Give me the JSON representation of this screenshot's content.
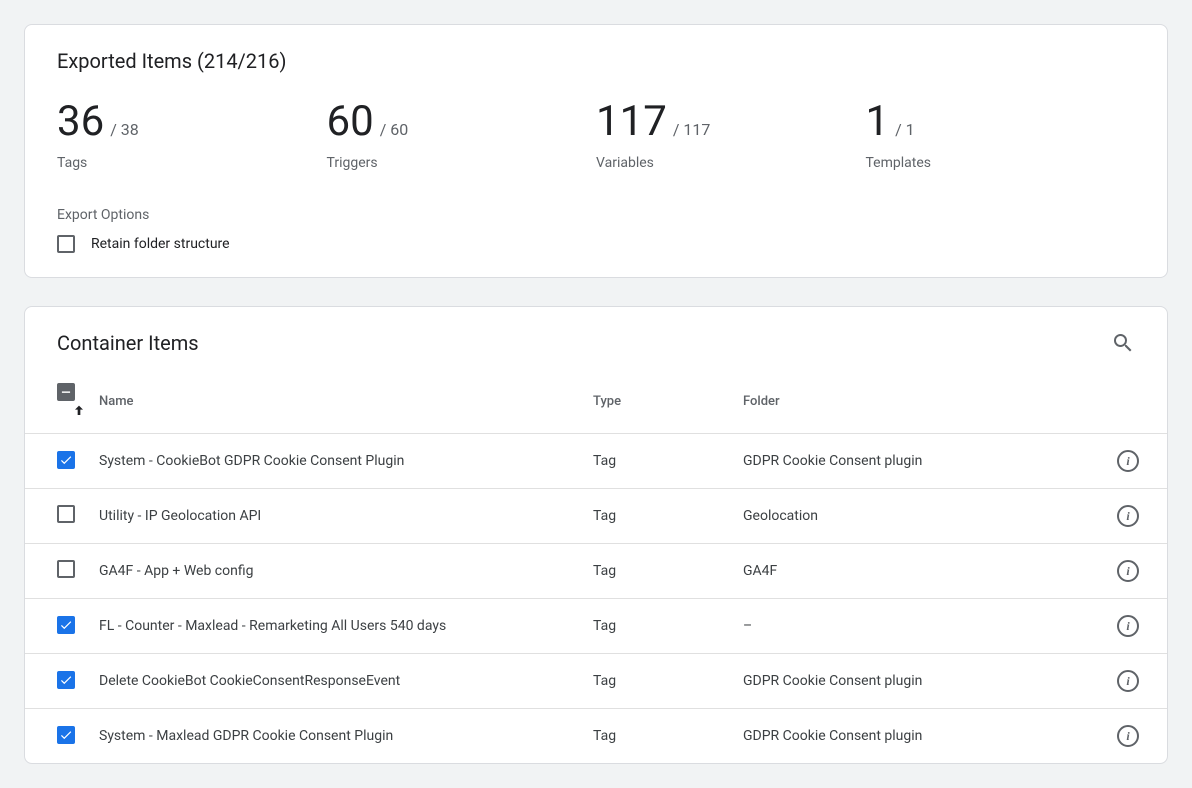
{
  "summary": {
    "title": "Exported Items (214/216)",
    "stats": [
      {
        "value": "36",
        "total": "/ 38",
        "label": "Tags"
      },
      {
        "value": "60",
        "total": "/ 60",
        "label": "Triggers"
      },
      {
        "value": "117",
        "total": "/ 117",
        "label": "Variables"
      },
      {
        "value": "1",
        "total": "/ 1",
        "label": "Templates"
      }
    ],
    "export_options_label": "Export Options",
    "retain_label": "Retain folder structure",
    "retain_checked": false
  },
  "table": {
    "title": "Container Items",
    "columns": {
      "name": "Name",
      "type": "Type",
      "folder": "Folder"
    },
    "rows": [
      {
        "checked": true,
        "name": "System - CookieBot GDPR Cookie Consent Plugin",
        "type": "Tag",
        "folder": "GDPR Cookie Consent plugin"
      },
      {
        "checked": false,
        "name": "Utility - IP Geolocation API",
        "type": "Tag",
        "folder": "Geolocation"
      },
      {
        "checked": false,
        "name": "GA4F - App + Web config",
        "type": "Tag",
        "folder": "GA4F"
      },
      {
        "checked": true,
        "name": "FL - Counter - Maxlead - Remarketing All Users 540 days",
        "type": "Tag",
        "folder": "–"
      },
      {
        "checked": true,
        "name": "Delete CookieBot CookieConsentResponseEvent",
        "type": "Tag",
        "folder": "GDPR Cookie Consent plugin"
      },
      {
        "checked": true,
        "name": "System - Maxlead GDPR Cookie Consent Plugin",
        "type": "Tag",
        "folder": "GDPR Cookie Consent plugin"
      }
    ]
  }
}
